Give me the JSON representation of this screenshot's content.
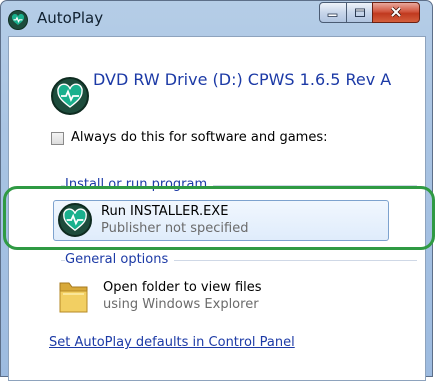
{
  "window": {
    "title": "AutoPlay",
    "controls": {
      "minimize_icon": "minimize-icon",
      "maximize_icon": "maximize-icon",
      "close_icon": "close-icon"
    }
  },
  "device": {
    "title": "DVD RW Drive (D:) CPWS 1.6.5 Rev A",
    "icon": "heart-monitor-icon"
  },
  "always_checkbox": {
    "label": "Always do this for software and games:",
    "checked": false
  },
  "sections": {
    "install": {
      "heading": "Install or run program",
      "option": {
        "label": "Run INSTALLER.EXE",
        "sublabel": "Publisher not specified",
        "icon": "heart-monitor-icon"
      }
    },
    "general": {
      "heading": "General options",
      "option": {
        "label": "Open folder to view files",
        "sublabel": "using Windows Explorer",
        "icon": "folder-icon"
      }
    }
  },
  "footer": {
    "link": "Set AutoPlay defaults in Control Panel"
  },
  "colors": {
    "link": "#1c3aa6",
    "highlight": "#2f9a43",
    "icon_bg": "#1d4c3c",
    "icon_heart": "#19b08d",
    "close_button": "#c0391f"
  }
}
